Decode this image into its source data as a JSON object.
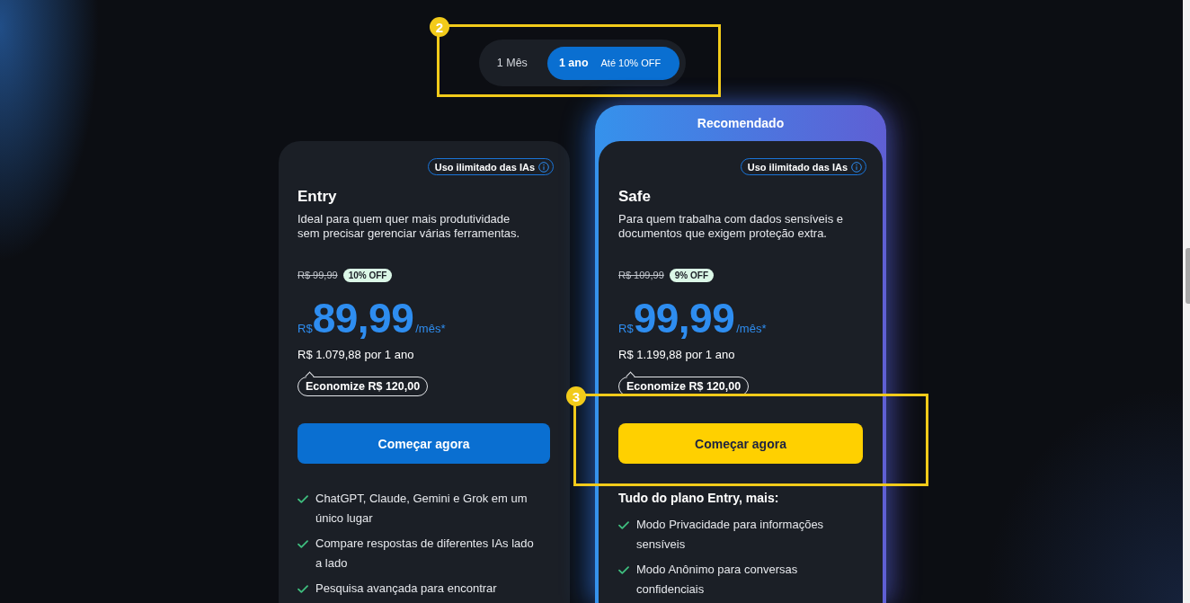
{
  "billing_toggle": {
    "options": [
      {
        "label": "1 Mês",
        "selected": false
      },
      {
        "label": "1 ano",
        "note": "Até 10% OFF",
        "selected": true
      }
    ]
  },
  "plans": [
    {
      "name": "Entry",
      "badge": "Uso ilimitado das IAs",
      "description": "Ideal para quem quer mais produtividade sem precisar gerenciar várias ferramentas.",
      "old_price": "R$ 99,99",
      "discount": "10% OFF",
      "currency": "R$",
      "price": "89,99",
      "period": "/mês*",
      "annual_total": "R$ 1.079,88 por 1 ano",
      "savings": "Economize R$ 120,00",
      "cta": {
        "label": "Começar agora",
        "kind": "standard"
      },
      "features": [
        "ChatGPT, Claude, Gemini e Grok em um único lugar",
        "Compare respostas de diferentes IAs lado a lado",
        "Pesquisa avançada para encontrar"
      ]
    },
    {
      "ribbon": "Recomendado",
      "name": "Safe",
      "badge": "Uso ilimitado das IAs",
      "description": "Para quem trabalha com dados sensíveis e documentos que exigem proteção extra.",
      "old_price": "R$ 109,99",
      "discount": "9% OFF",
      "currency": "R$",
      "price": "99,99",
      "period": "/mês*",
      "annual_total": "R$ 1.199,88 por 1 ano",
      "savings": "Economize R$ 120,00",
      "cta": {
        "label": "Começar agora",
        "kind": "featured"
      },
      "features_heading": "Tudo do plano Entry, mais:",
      "features": [
        "Modo Privacidade para informações sensíveis",
        "Modo Anônimo para conversas confidenciais"
      ]
    }
  ],
  "annotations": [
    {
      "label": "2"
    },
    {
      "label": "3"
    }
  ]
}
